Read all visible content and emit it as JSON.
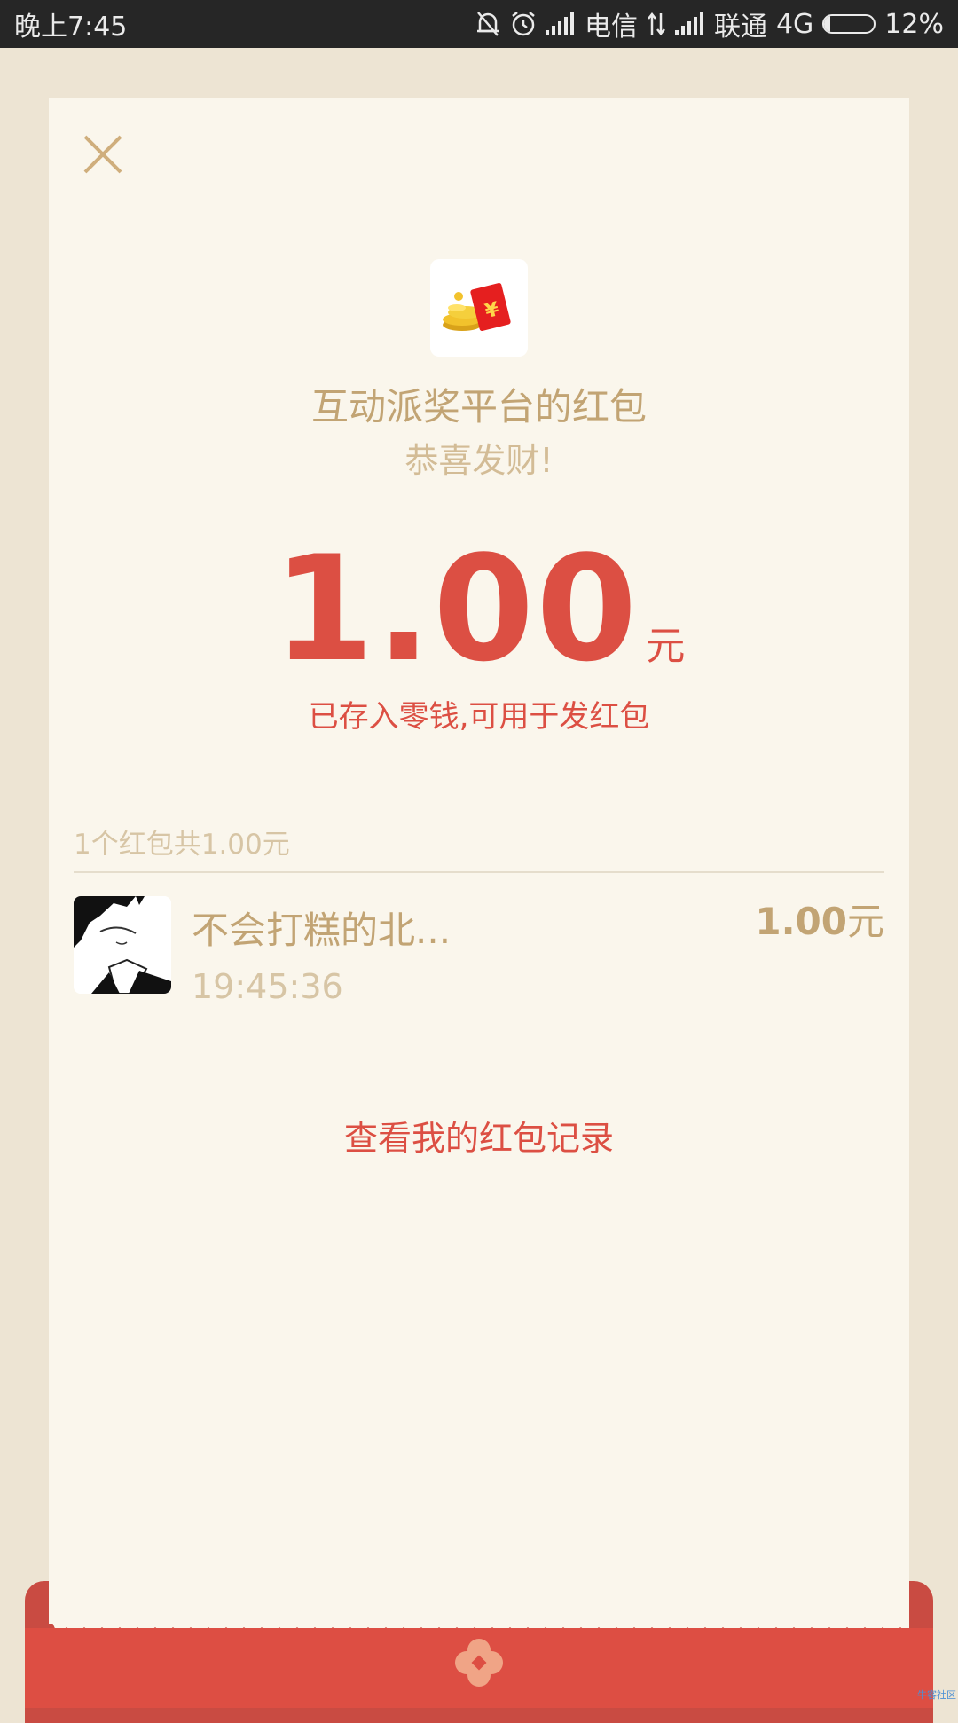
{
  "status_bar": {
    "time": "晚上7:45",
    "carrier1": "电信",
    "carrier2": "联通",
    "network": "4G",
    "battery_percent_text": "12%",
    "battery_level": 0.12
  },
  "card": {
    "title": "互动派奖平台的红包",
    "subtitle": "恭喜发财!",
    "amount": "1.00",
    "amount_unit": "元",
    "saved_note": "已存入零钱,可用于发红包",
    "summary": "1个红包共1.00元",
    "history_link": "查看我的红包记录"
  },
  "records": [
    {
      "name": "不会打糕的北...",
      "time": "19:45:36",
      "amount": "1.00",
      "unit": "元"
    }
  ],
  "watermark": "牛客社区",
  "colors": {
    "accent_red": "#dc4f43",
    "gold_text": "#c2a474",
    "card_bg": "#faf6ec",
    "page_bg": "#ede4d3"
  }
}
